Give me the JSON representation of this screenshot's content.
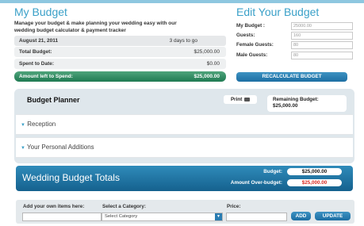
{
  "my_budget": {
    "title": "My Budget",
    "subtitle_line1": "Manage your budget & make planning your wedding easy with our",
    "subtitle_line2": "wedding budget calculator & payment tracker",
    "date": "August 21, 2011",
    "days_to_go": "3 days to go",
    "rows": [
      {
        "label": "Total Budget:",
        "value": "$25,000.00"
      },
      {
        "label": "Spent to Date:",
        "value": "$0.00"
      }
    ],
    "left_label": "Amount left to Spend:",
    "left_value": "$25,000.00"
  },
  "edit_budget": {
    "title": "Edit Your Budget",
    "fields": [
      {
        "label": "My Budget :",
        "value": "25000.00"
      },
      {
        "label": "Guests:",
        "value": "160"
      },
      {
        "label": "Female Guests:",
        "value": "80"
      },
      {
        "label": "Male Guests:",
        "value": "80"
      }
    ],
    "recalc_label": "RECALCULATE BUDGET"
  },
  "planner": {
    "title": "Budget Planner",
    "print_label": "Print",
    "remaining_label": "Remaining Budget:",
    "remaining_value": "$25,000.00",
    "sections": [
      {
        "arrow": "▼",
        "label": "Reception"
      },
      {
        "arrow": "▼",
        "label": "Your Personal Additions"
      }
    ]
  },
  "totals": {
    "title": "Wedding Budget Totals",
    "budget_label": "Budget:",
    "budget_value": "$25,000.00",
    "over_label": "Amount Over-budget:",
    "over_value": "$25,000.00"
  },
  "add_items": {
    "own_label": "Add your own items here:",
    "category_label": "Select a Category:",
    "category_value": "Select Category",
    "price_label": "Price:",
    "add_label": "ADD",
    "update_label": "UPDATE"
  },
  "colors": {
    "accent": "#3aa0c8",
    "green": "#2f8f63",
    "over": "#d9271f",
    "totals_bg": "#1f6f9e"
  }
}
